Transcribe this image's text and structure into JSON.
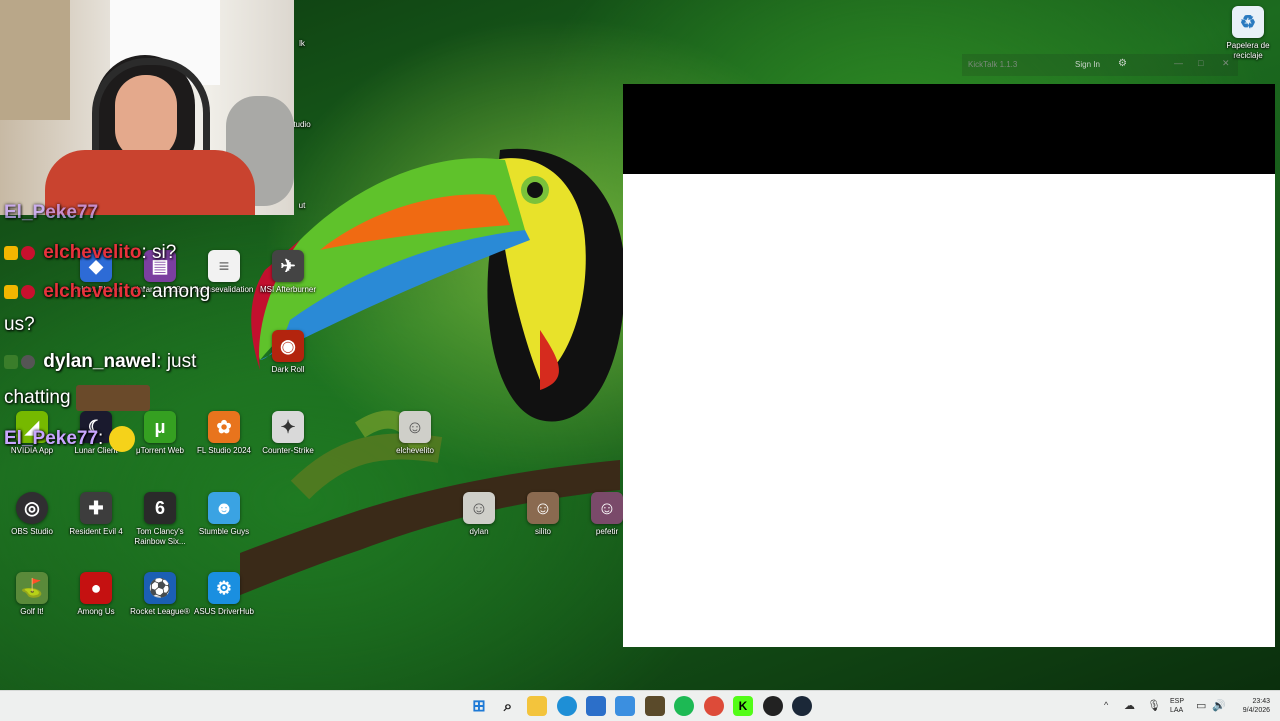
{
  "desktop": {
    "icons": [
      {
        "label": "Roblox Player",
        "color": "#2d6bd6",
        "glyph": "◆"
      },
      {
        "label": "winrar_v...713es",
        "color": "#7b3fa0",
        "glyph": "▤"
      },
      {
        "label": "licensevalidation",
        "color": "#f2f2f2",
        "glyph": "≡"
      },
      {
        "label": "MSI Afterburner",
        "color": "#444444",
        "glyph": "✈"
      },
      {
        "label": "Dark Roll",
        "color": "#b3240e",
        "glyph": "◉"
      },
      {
        "label": "NVIDIA App",
        "color": "#76b900",
        "glyph": "◢"
      },
      {
        "label": "Lunar Client",
        "color": "#1a1a2e",
        "glyph": "☾"
      },
      {
        "label": "μTorrent Web",
        "color": "#35a021",
        "glyph": "μ"
      },
      {
        "label": "FL Studio 2024",
        "color": "#e8741d",
        "glyph": "✿"
      },
      {
        "label": "Counter-Strike",
        "color": "#d9d9d9",
        "glyph": "✦"
      },
      {
        "label": "elchevelito",
        "color": "#cfcfc9",
        "glyph": "☺"
      },
      {
        "label": "OBS Studio",
        "color": "#302e31",
        "glyph": "◎"
      },
      {
        "label": "Resident Evil 4",
        "color": "#3d3d3d",
        "glyph": "✚"
      },
      {
        "label": "Tom Clancy's Rainbow Six...",
        "color": "#2a2a2a",
        "glyph": "6"
      },
      {
        "label": "Stumble Guys",
        "color": "#3aa3e3",
        "glyph": "☻"
      },
      {
        "label": "dylan",
        "color": "#cfcfc9",
        "glyph": "☺"
      },
      {
        "label": "silito",
        "color": "#8a6a50",
        "glyph": "☺"
      },
      {
        "label": "pefetir",
        "color": "#7a4a6a",
        "glyph": "☺"
      },
      {
        "label": "Golf It!",
        "color": "#5a8a3a",
        "glyph": "⛳"
      },
      {
        "label": "Among Us",
        "color": "#c51111",
        "glyph": "●"
      },
      {
        "label": "Rocket League®",
        "color": "#1b5fb4",
        "glyph": "⚽"
      },
      {
        "label": "ASUS DriverHub",
        "color": "#1a8fe0",
        "glyph": "⚙"
      },
      {
        "label": "Papelera de reciclaje",
        "color": "#e8f0f8",
        "glyph": "♻"
      }
    ],
    "partial_labels": [
      "lk",
      "tudio",
      "ut"
    ]
  },
  "chat": {
    "lines": [
      {
        "user": "El_Peke77",
        "msg": "",
        "user_color": "#c9a6ff"
      },
      {
        "user": "elchevelito",
        "msg": ": si?",
        "user_color": "#e8323c"
      },
      {
        "user": "elchevelito",
        "msg": ": among",
        "user_color": "#e8323c"
      },
      {
        "user": "",
        "msg": "us?",
        "user_color": "#ffffff"
      },
      {
        "user": "dylan_nawel",
        "msg": ": just",
        "user_color": "#ffffff"
      },
      {
        "user": "",
        "msg": "chatting",
        "user_color": "#ffffff"
      },
      {
        "user": "El_Peke77",
        "msg": ":",
        "user_color": "#c9a6ff"
      }
    ]
  },
  "kicktalk": {
    "title": "KickTalk 1.1.3",
    "sign_in": "Sign In",
    "settings_icon": "⚙",
    "minimize": "—",
    "maximize": "□",
    "close": "✕"
  },
  "taskbar": {
    "tray_expand": "^",
    "language_top": "ESP",
    "language_bottom": "LAA",
    "time": "23:43",
    "date": "9/4/2026"
  }
}
